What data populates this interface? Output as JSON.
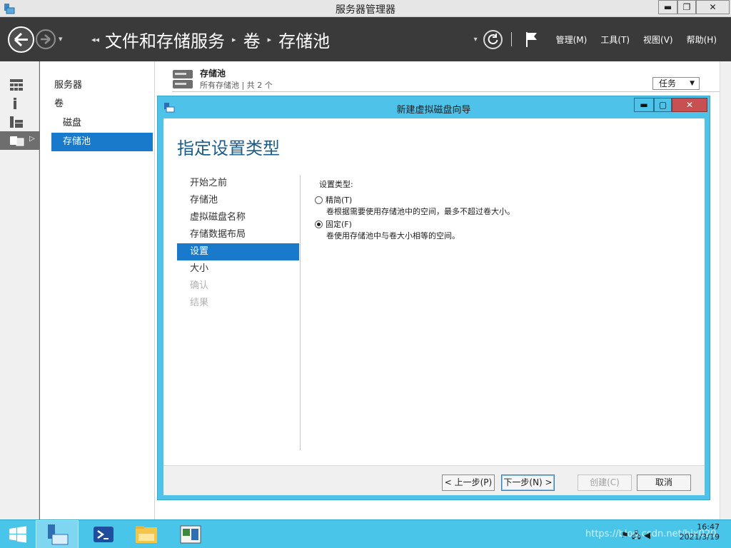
{
  "window": {
    "title": "服务器管理器"
  },
  "window_buttons": {
    "min": "▬",
    "max": "❐",
    "close": "✕"
  },
  "breadcrumb": {
    "lead": "◂◂",
    "items": [
      "文件和存储服务",
      "卷",
      "存储池"
    ],
    "sep": "▸"
  },
  "nav_right": {
    "dropdown": "▾",
    "menus": [
      "管理(M)",
      "工具(T)",
      "视图(V)",
      "帮助(H)"
    ]
  },
  "nav_drop": "▾",
  "rail": {
    "arrow": "▷"
  },
  "navlist": {
    "items": [
      {
        "label": "服务器"
      },
      {
        "label": "卷"
      },
      {
        "label": "磁盘"
      },
      {
        "label": "存储池"
      }
    ]
  },
  "main": {
    "pool_title": "存储池",
    "pool_subtitle": "所有存储池 | 共 2 个",
    "task_label": "任务",
    "task_caret": "▼"
  },
  "dialog": {
    "title": "新建虚拟磁盘向导",
    "buttons": {
      "min": "▬",
      "max": "▢",
      "close": "✕"
    },
    "heading": "指定设置类型",
    "steps": [
      {
        "label": "开始之前",
        "state": "normal"
      },
      {
        "label": "存储池",
        "state": "normal"
      },
      {
        "label": "虚拟磁盘名称",
        "state": "normal"
      },
      {
        "label": "存储数据布局",
        "state": "normal"
      },
      {
        "label": "设置",
        "state": "active"
      },
      {
        "label": "大小",
        "state": "normal"
      },
      {
        "label": "确认",
        "state": "disabled"
      },
      {
        "label": "结果",
        "state": "disabled"
      }
    ],
    "settings": {
      "label": "设置类型:",
      "options": [
        {
          "label": "精简(T)",
          "description": "卷根据需要使用存储池中的空间，最多不超过卷大小。",
          "selected": false
        },
        {
          "label": "固定(F)",
          "description": "卷使用存储池中与卷大小相等的空间。",
          "selected": true
        }
      ]
    },
    "footer": {
      "prev": "< 上一步(P)",
      "next": "下一步(N) >",
      "create": "创建(C)",
      "cancel": "取消"
    }
  },
  "taskbar": {
    "time": "16:47",
    "date": "2021/3/19",
    "watermark": "https://blog.csdn.net/hjx020"
  },
  "colors": {
    "accent": "#1979ca",
    "dialog": "#4fc2ea",
    "taskbar": "#49c5ea",
    "navbar": "#3a3a3a"
  }
}
